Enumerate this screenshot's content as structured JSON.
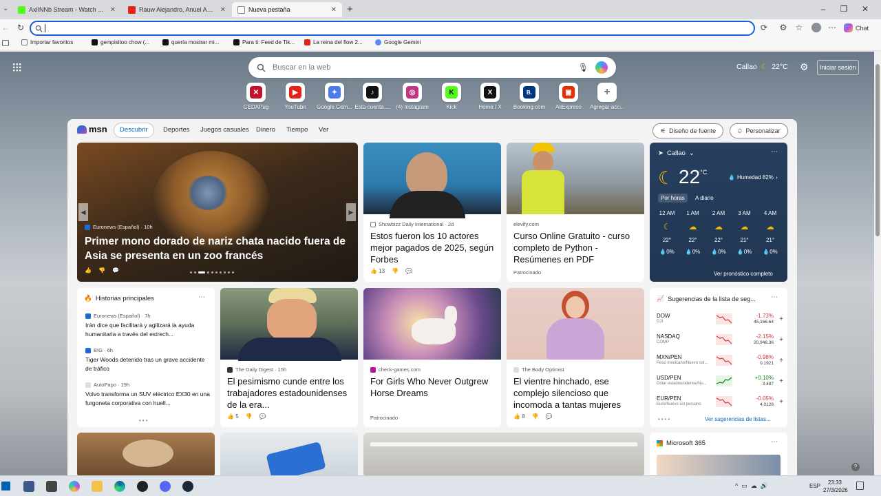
{
  "tabs": [
    {
      "title": "AxlINNb Stream - Watch Live on Ki",
      "color": "#1a1a1a"
    },
    {
      "title": "Rauw Alejandro, Anuel AA - Reloj",
      "color": "#e62117"
    },
    {
      "title": "Nueva pestaña",
      "color": "#999"
    }
  ],
  "favorites": [
    {
      "label": "Importar favoritos",
      "color": "#777"
    },
    {
      "label": "gempisitoo chow (...",
      "color": "#111"
    },
    {
      "label": "quería mostrar mi...",
      "color": "#111"
    },
    {
      "label": "Para ti: Feed de Tik...",
      "color": "#111"
    },
    {
      "label": "La reina del flow 2...",
      "color": "#e62117"
    },
    {
      "label": "Google Gemini",
      "color": "#5b8def"
    }
  ],
  "toolbar": {
    "chat_label": "Chat"
  },
  "header": {
    "location": "Callao",
    "temperature": "22°C",
    "signin": "Iniciar sesión"
  },
  "search": {
    "placeholder": "Buscar en la web"
  },
  "quicklinks": [
    {
      "label": "CEDAPug",
      "color": "#c8102e",
      "glyph": "✕"
    },
    {
      "label": "YouTube",
      "color": "#e62117",
      "glyph": "▶"
    },
    {
      "label": "Google Gem...",
      "color": "#4b7bec",
      "glyph": "✦"
    },
    {
      "label": "Esta cuenta ...",
      "color": "#111",
      "glyph": "♪"
    },
    {
      "label": "(4) Instagram",
      "color": "#c13584",
      "glyph": "◎"
    },
    {
      "label": "Kick",
      "color": "#53fc18",
      "glyph": "K"
    },
    {
      "label": "Home / X",
      "color": "#111",
      "glyph": "X"
    },
    {
      "label": "Booking.com",
      "color": "#003580",
      "glyph": "B."
    },
    {
      "label": "AliExpress",
      "color": "#e62e04",
      "glyph": "▣"
    },
    {
      "label": "Agregar acc...",
      "color": "#888",
      "glyph": "+"
    }
  ],
  "feed": {
    "brand": "msn",
    "tabs": [
      "Descubrir",
      "Deportes",
      "Juegos casuales",
      "Dinero",
      "Tiempo",
      "Ver"
    ],
    "source_btn": "Diseño de fuente",
    "personalize_btn": "Personalizar",
    "hero": {
      "source": "Euronews (Español) · 10h",
      "title": "Primer mono dorado de nariz chata nacido fuera de Asia se presenta en un zoo francés"
    },
    "card1": {
      "source": "Showbizz Daily International · 2d",
      "title": "Estos fueron los 10 actores mejor pagados de 2025, según Forbes",
      "likes": "13"
    },
    "card2": {
      "source": "elevify.com",
      "title": "Curso Online Gratuito - curso completo de Python - Resúmenes en PDF",
      "sponsored": "Patrocinado"
    },
    "weather": {
      "location": "Callao",
      "temp": "22",
      "unit": "°C",
      "humidity": "Humedad 82%",
      "tab_hourly": "Por horas",
      "tab_daily": "A diario",
      "hours": [
        {
          "t": "12 AM",
          "temp": "22°",
          "rain": "0%"
        },
        {
          "t": "1 AM",
          "temp": "22°",
          "rain": "0%"
        },
        {
          "t": "2 AM",
          "temp": "22°",
          "rain": "0%"
        },
        {
          "t": "3 AM",
          "temp": "21°",
          "rain": "0%"
        },
        {
          "t": "4 AM",
          "temp": "21°",
          "rain": "0%"
        }
      ],
      "full": "Ver pronóstico completo"
    },
    "top": {
      "title": "Historias principales",
      "items": [
        {
          "source": "Euronews (Español) · 7h",
          "title": "Irán dice que facilitará y agilizará la ayuda humanitaria a través del estrech..."
        },
        {
          "source": "BIG · 6h",
          "title": "Tiger Woods detenido tras un grave accidente de tráfico"
        },
        {
          "source": "AutoPapo · 19h",
          "title": "Volvo transforma un SUV eléctrico EX30 en una furgoneta corporativa con huell..."
        }
      ]
    },
    "card3": {
      "source": "The Daily Digest · 15h",
      "title": "El pesimismo cunde entre los trabajadores estadounidenses de la era...",
      "likes": "5"
    },
    "card4": {
      "source": "check-games.com",
      "title": "For Girls Who Never Outgrew Horse Dreams",
      "sponsored": "Patrocinado"
    },
    "card5": {
      "source": "The Body Optimist",
      "title": "El vientre hinchado, ese complejo silencioso que incomoda a tantas mujeres",
      "likes": "8"
    },
    "stocks": {
      "title": "Sugerencias de la lista de seg...",
      "items": [
        {
          "sym": "DOW",
          "sub": "DJI",
          "chg": "-1.73%",
          "val": "45,166.64",
          "color": "#d13438"
        },
        {
          "sym": "NASDAQ",
          "sub": "COMP",
          "chg": "-2.15%",
          "val": "20,948.36",
          "color": "#d13438"
        },
        {
          "sym": "MXN/PEN",
          "sub": "Peso mexicano/Nuevo sol...",
          "chg": "-0.98%",
          "val": "0.1921",
          "color": "#d13438"
        },
        {
          "sym": "USD/PEN",
          "sub": "Dólar estadounidense/Nu...",
          "chg": "+0.10%",
          "val": "3.487",
          "color": "#107c10"
        },
        {
          "sym": "EUR/PEN",
          "sub": "Euro/Nuevo sol peruano",
          "chg": "-0.05%",
          "val": "4.0128",
          "color": "#d13438"
        }
      ],
      "more": "Ver sugerencias de listas..."
    },
    "m365": {
      "title": "Microsoft 365"
    }
  },
  "taskbar": {
    "lang": "ESP",
    "time": "23:33",
    "date": "27/3/2026"
  }
}
